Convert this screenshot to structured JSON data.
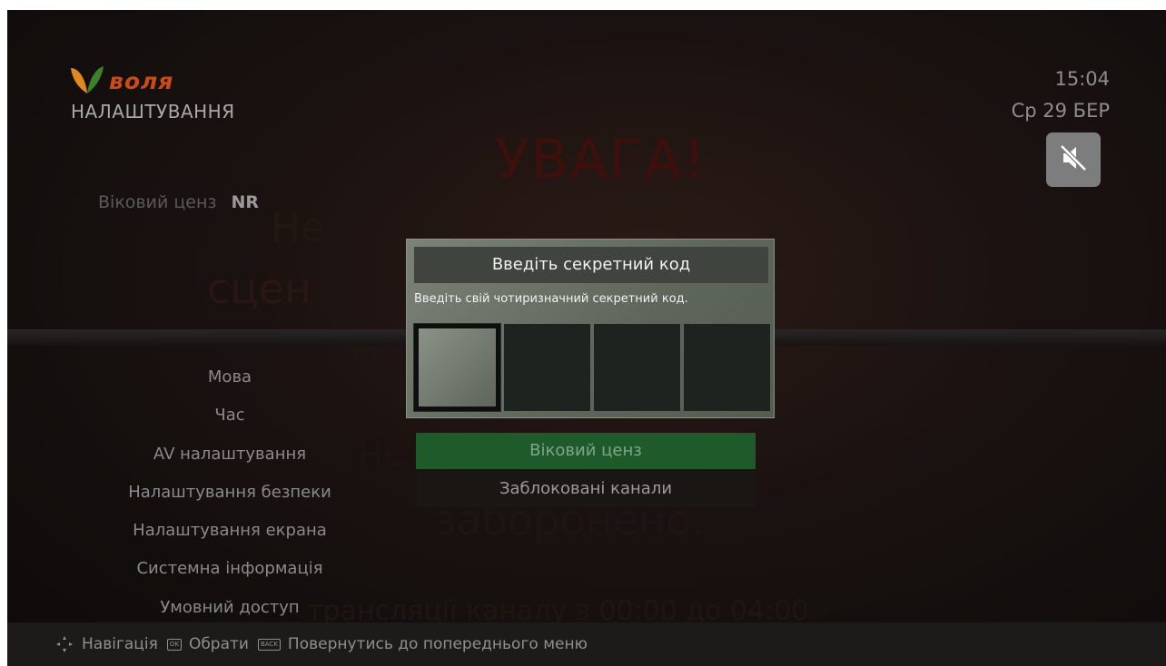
{
  "header": {
    "logo_text": "воля",
    "section_title": "НАЛАШТУВАННЯ",
    "time": "15:04",
    "date": "Ср 29 БЕР"
  },
  "icons": {
    "logo": "volia-leaf-logo",
    "mute": "speaker-muted-icon",
    "navigation": "dpad-arrows-icon",
    "ok_key": "ok-key-icon",
    "back_key": "back-key-icon"
  },
  "background_warning": {
    "title": "УВАГА!",
    "line1": "Не",
    "line2": "сцен",
    "line3": "м",
    "line4": "не",
    "line5": "заборонено.",
    "line6": "трансляції каналу з 00:00 до 04:00"
  },
  "age_rating": {
    "label": "Віковий ценз",
    "value": "NR"
  },
  "menu": {
    "items": [
      {
        "label": "Мова"
      },
      {
        "label": "Час"
      },
      {
        "label": "AV налаштування"
      },
      {
        "label": "Налаштування безпеки"
      },
      {
        "label": "Налаштування екрана"
      },
      {
        "label": "Системна інформація"
      },
      {
        "label": "Умовний доступ"
      }
    ]
  },
  "submenu": {
    "items": [
      {
        "label": "Віковий ценз",
        "selected": true
      },
      {
        "label": "Заблоковані канали",
        "selected": false
      }
    ]
  },
  "pin_dialog": {
    "title": "Введіть секретний код",
    "message": "Введіть свій чотиризначний секретний код.",
    "digits": [
      "",
      "",
      "",
      ""
    ],
    "active_index": 0
  },
  "footer": {
    "nav_label": "Навігація",
    "ok_key": "OK",
    "ok_label": "Обрати",
    "back_key": "BACK",
    "back_label": "Повернутись до попереднього меню"
  },
  "colors": {
    "brand": "#c94b16",
    "selected": "#1f5a2a",
    "dialog": "#6b7368"
  }
}
